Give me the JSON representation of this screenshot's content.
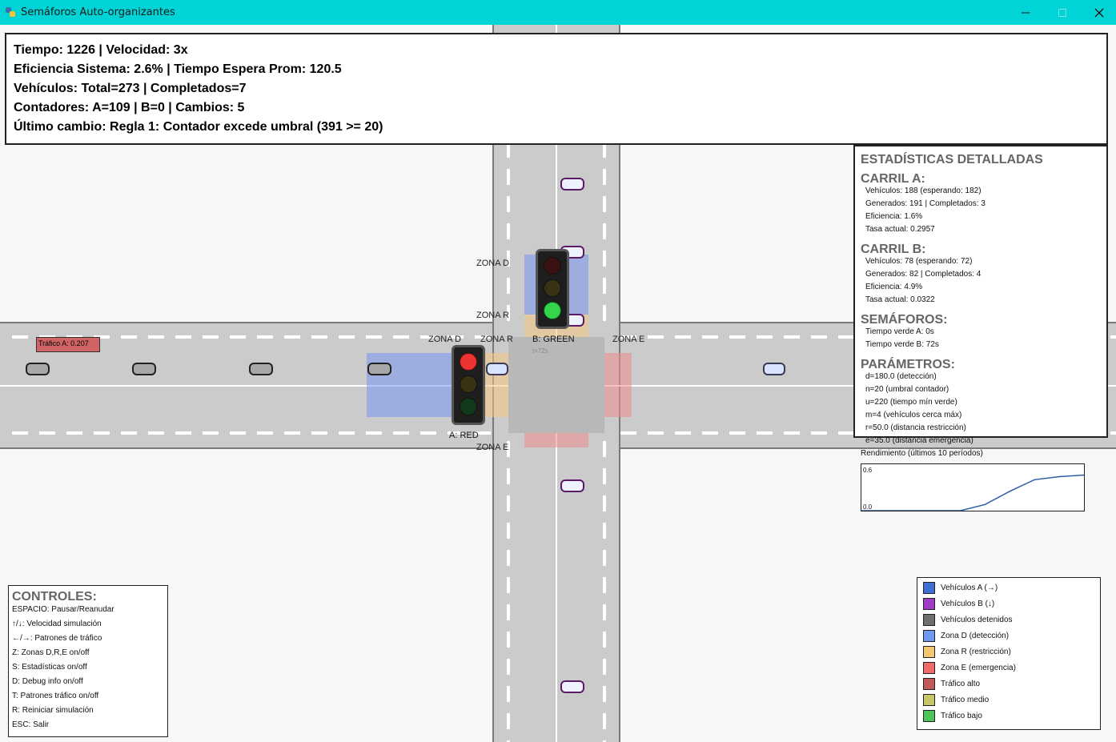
{
  "window": {
    "title": "Semáforos Auto-organizantes",
    "icon": "python-snake-icon",
    "title_bar_color": "#00d4d6"
  },
  "info": {
    "line1": "Tiempo: 1226 | Velocidad: 3x",
    "line2": "Eficiencia Sistema: 2.6% | Tiempo Espera Prom: 120.5",
    "line3": "Vehículos: Total=273 | Completados=7",
    "line4": "Contadores: A=109 | B=0 | Cambios: 5",
    "line5": "Último cambio: Regla 1: Contador excede umbral (391 >= 20)"
  },
  "map": {
    "traffic_badge": "Tráfico A: 0.207",
    "zone_labels": {
      "b_zone_d": "ZONA D",
      "b_zone_r": "ZONA R",
      "a_zone_d": "ZONA D",
      "a_zone_r": "ZONA R",
      "a_zone_e": "ZONA E",
      "b_zone_e": "ZONA E"
    },
    "light_a": {
      "label": "A: RED",
      "state": "red"
    },
    "light_b": {
      "label": "B: GREEN",
      "state": "green",
      "timer": "t=72s"
    }
  },
  "stats": {
    "title": "ESTADÍSTICAS DETALLADAS",
    "carril_a": {
      "heading": "CARRIL A:",
      "vehiculos": "Vehículos: 188 (esperando: 182)",
      "generados": "Generados: 191 | Completados: 3",
      "eficiencia": "Eficiencia: 1.6%",
      "tasa": "Tasa actual: 0.2957"
    },
    "carril_b": {
      "heading": "CARRIL B:",
      "vehiculos": "Vehículos: 78 (esperando: 72)",
      "generados": "Generados: 82 | Completados: 4",
      "eficiencia": "Eficiencia: 4.9%",
      "tasa": "Tasa actual: 0.0322"
    },
    "semaforos": {
      "heading": "SEMÁFOROS:",
      "verde_a": "Tiempo verde A: 0s",
      "verde_b": "Tiempo verde B: 72s"
    },
    "parametros": {
      "heading": "PARÁMETROS:",
      "d": "d=180.0 (detección)",
      "n": "n=20 (umbral contador)",
      "u": "u=220 (tiempo mín verde)",
      "m": "m=4 (vehículos cerca máx)",
      "r": "r=50.0 (distancia restricción)",
      "e": "e=35.0 (distancia emergencia)"
    },
    "performance": {
      "title": "Rendimiento (últimos 10 períodos)",
      "y_max_label": "0.6",
      "y_min_label": "0.0"
    }
  },
  "chart_data": {
    "type": "line",
    "title": "Rendimiento (últimos 10 períodos)",
    "x": [
      1,
      2,
      3,
      4,
      5,
      6,
      7,
      8,
      9,
      10
    ],
    "series": [
      {
        "values": [
          0.0,
          0.0,
          0.0,
          0.0,
          0.0,
          0.08,
          0.25,
          0.4,
          0.44,
          0.46
        ]
      }
    ],
    "ylim": [
      0.0,
      0.6
    ],
    "line_color": "#2f5ea8"
  },
  "controls": {
    "title": "CONTROLES:",
    "items": [
      "ESPACIO: Pausar/Reanudar",
      "↑/↓: Velocidad simulación",
      "←/→: Patrones de tráfico",
      "Z: Zonas D,R,E on/off",
      "S: Estadísticas on/off",
      "D: Debug info on/off",
      "T: Patrones tráfico on/off",
      "R: Reiniciar simulación",
      "ESC: Salir"
    ]
  },
  "legend": {
    "items": [
      {
        "label": "Vehículos A (→)",
        "color": "#3f6fd0"
      },
      {
        "label": "Vehículos B (↓)",
        "color": "#a03cc8"
      },
      {
        "label": "Vehículos detenidos",
        "color": "#6e6e6e"
      },
      {
        "label": "Zona D (detección)",
        "color": "#6f98f0"
      },
      {
        "label": "Zona R (restricción)",
        "color": "#f3c66f"
      },
      {
        "label": "Zona E (emergencia)",
        "color": "#f06a6a"
      },
      {
        "label": "Tráfico alto",
        "color": "#c25a5a"
      },
      {
        "label": "Tráfico medio",
        "color": "#c8c46a"
      },
      {
        "label": "Tráfico bajo",
        "color": "#4cc45a"
      }
    ]
  }
}
